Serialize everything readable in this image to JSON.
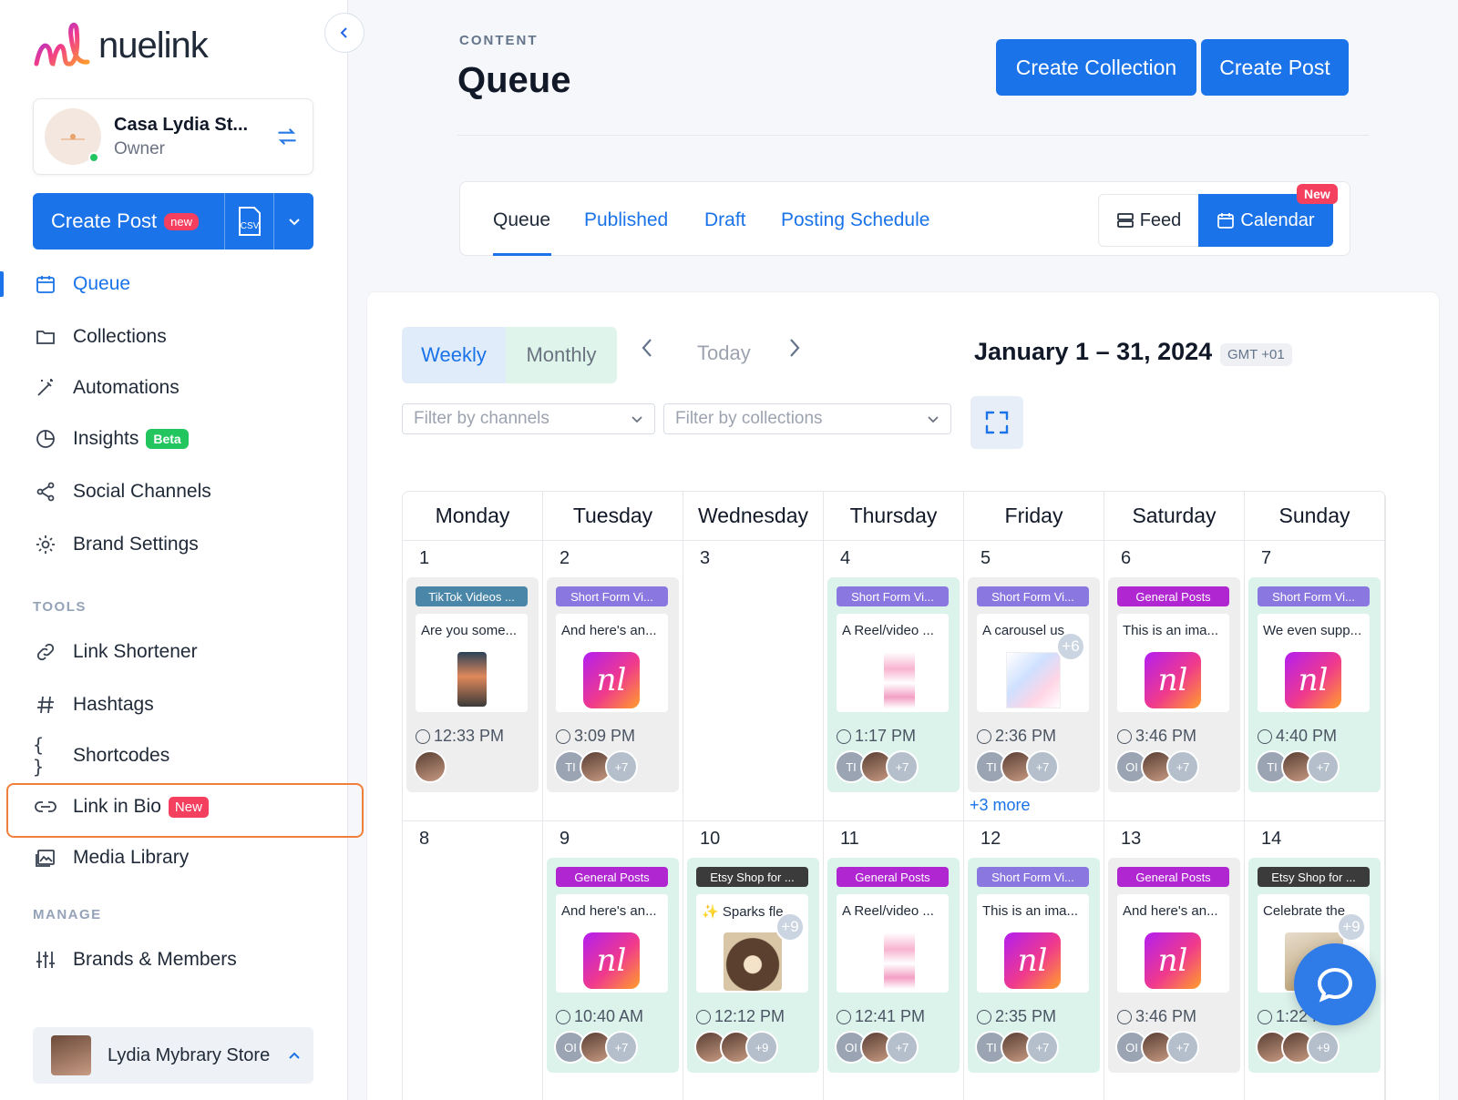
{
  "brand": {
    "name": "nuelink",
    "accent": "#1a73e8"
  },
  "account": {
    "name": "Casa Lydia St...",
    "role": "Owner"
  },
  "sidebar": {
    "create_post": {
      "label": "Create Post",
      "badge": "new",
      "csv_icon": "csv-icon"
    },
    "items": [
      {
        "label": "Queue",
        "icon": "calendar-icon",
        "active": true
      },
      {
        "label": "Collections",
        "icon": "folder-icon"
      },
      {
        "label": "Automations",
        "icon": "magic-wand-icon"
      },
      {
        "label": "Insights",
        "icon": "pie-chart-icon",
        "badge": "Beta"
      },
      {
        "label": "Social Channels",
        "icon": "share-icon"
      },
      {
        "label": "Brand Settings",
        "icon": "gear-icon"
      }
    ],
    "tools_label": "TOOLS",
    "tools": [
      {
        "label": "Link Shortener",
        "icon": "link-icon"
      },
      {
        "label": "Hashtags",
        "icon": "hash-icon"
      },
      {
        "label": "Shortcodes",
        "icon": "braces-icon"
      },
      {
        "label": "Link in Bio",
        "icon": "link-icon",
        "badge": "New",
        "highlighted": true
      },
      {
        "label": "Media Library",
        "icon": "image-icon"
      }
    ],
    "manage_label": "MANAGE",
    "manage": [
      {
        "label": "Brands & Members",
        "icon": "sliders-icon"
      }
    ],
    "store": {
      "name": "Lydia Mybrary Store"
    }
  },
  "header": {
    "section": "CONTENT",
    "title": "Queue",
    "create_collection": "Create Collection",
    "create_post": "Create Post"
  },
  "tabs": {
    "items": [
      "Queue",
      "Published",
      "Draft",
      "Posting Schedule"
    ],
    "active": "Queue",
    "feed": "Feed",
    "calendar": "Calendar",
    "new_badge": "New"
  },
  "calendar": {
    "weekly": "Weekly",
    "monthly": "Monthly",
    "today": "Today",
    "range": "January 1 – 31, 2024",
    "tz": "GMT +01",
    "filter_channels": "Filter by channels",
    "filter_collections": "Filter by collections",
    "days": [
      "Monday",
      "Tuesday",
      "Wednesday",
      "Thursday",
      "Friday",
      "Saturday",
      "Sunday"
    ],
    "weeks": [
      [
        {
          "day": "1",
          "post": {
            "tag": "TikTok Videos ...",
            "tag_color": "#4a86a8",
            "text": "Are you some...",
            "thumb": "phone",
            "time": "12:33 PM",
            "avatars": [
              "photo"
            ],
            "bg": "grey"
          }
        },
        {
          "day": "2",
          "post": {
            "tag": "Short Form Vi...",
            "tag_color": "#8a78e0",
            "text": "And here's an...",
            "thumb": "nl",
            "time": "3:09 PM",
            "avatars": [
              "TI",
              "photo"
            ],
            "more": "+7",
            "bg": "grey"
          }
        },
        {
          "day": "3"
        },
        {
          "day": "4",
          "post": {
            "tag": "Short Form Vi...",
            "tag_color": "#8a78e0",
            "text": "A Reel/video ...",
            "thumb": "pink",
            "time": "1:17 PM",
            "avatars": [
              "TI",
              "photo"
            ],
            "more": "+7",
            "bg": "mint"
          }
        },
        {
          "day": "5",
          "post": {
            "tag": "Short Form Vi...",
            "tag_color": "#8a78e0",
            "text": "A carousel us",
            "thumb": "carousel",
            "plus": "+6",
            "time": "2:36 PM",
            "avatars": [
              "TI",
              "photo"
            ],
            "more": "+7",
            "bg": "grey"
          },
          "more_link": "+3 more"
        },
        {
          "day": "6",
          "post": {
            "tag": "General Posts",
            "tag_color": "#b026d1",
            "text": "This is an ima...",
            "thumb": "nl",
            "time": "3:46 PM",
            "avatars": [
              "OI",
              "photo"
            ],
            "more": "+7",
            "bg": "grey"
          }
        },
        {
          "day": "7",
          "post": {
            "tag": "Short Form Vi...",
            "tag_color": "#8a78e0",
            "text": "We even supp...",
            "thumb": "nl",
            "time": "4:40 PM",
            "avatars": [
              "TI",
              "photo"
            ],
            "more": "+7",
            "bg": "mint"
          }
        }
      ],
      [
        {
          "day": "8"
        },
        {
          "day": "9",
          "post": {
            "tag": "General Posts",
            "tag_color": "#b026d1",
            "text": "And here's an...",
            "thumb": "nl",
            "time": "10:40 AM",
            "avatars": [
              "OI",
              "photo"
            ],
            "more": "+7",
            "bg": "mint"
          }
        },
        {
          "day": "10",
          "post": {
            "tag": "Etsy Shop for ...",
            "tag_color": "#3b3b3b",
            "text": "✨ Sparks fle.",
            "thumb": "candle",
            "plus": "+9",
            "time": "12:12 PM",
            "avatars": [
              "photo",
              "photo"
            ],
            "more": "+9",
            "bg": "mint"
          }
        },
        {
          "day": "11",
          "post": {
            "tag": "General Posts",
            "tag_color": "#b026d1",
            "text": "A Reel/video ...",
            "thumb": "pink",
            "time": "12:41 PM",
            "avatars": [
              "OI",
              "photo"
            ],
            "more": "+7",
            "bg": "mint"
          }
        },
        {
          "day": "12",
          "post": {
            "tag": "Short Form Vi...",
            "tag_color": "#8a78e0",
            "text": "This is an ima...",
            "thumb": "nl",
            "time": "2:35 PM",
            "avatars": [
              "TI",
              "photo"
            ],
            "more": "+7",
            "bg": "mint"
          }
        },
        {
          "day": "13",
          "post": {
            "tag": "General Posts",
            "tag_color": "#b026d1",
            "text": "And here's an...",
            "thumb": "nl",
            "time": "3:46 PM",
            "avatars": [
              "OI",
              "photo"
            ],
            "more": "+7",
            "bg": "grey"
          }
        },
        {
          "day": "14",
          "post": {
            "tag": "Etsy Shop for ...",
            "tag_color": "#3b3b3b",
            "text": "Celebrate the",
            "thumb": "plant",
            "plus": "+9",
            "time": "1:22 PM",
            "avatars": [
              "photo",
              "photo"
            ],
            "more": "+9",
            "bg": "mint"
          }
        }
      ]
    ]
  }
}
